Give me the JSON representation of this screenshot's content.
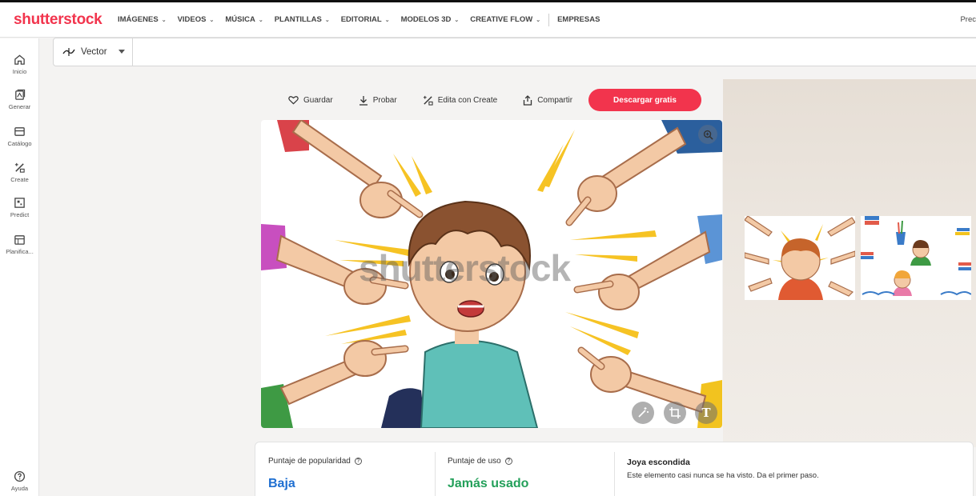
{
  "header": {
    "logo": "shutterstock",
    "nav": [
      {
        "label": "IMÁGENES",
        "caret": true
      },
      {
        "label": "VIDEOS",
        "caret": true
      },
      {
        "label": "MÚSICA",
        "caret": true
      },
      {
        "label": "PLANTILLAS",
        "caret": true
      },
      {
        "label": "EDITORIAL",
        "caret": true
      },
      {
        "label": "MODELOS 3D",
        "caret": true
      },
      {
        "label": "CREATIVE FLOW",
        "caret": true
      },
      {
        "label": "EMPRESAS",
        "caret": false
      }
    ],
    "right_text": "Prec"
  },
  "sidebar": {
    "items": [
      {
        "label": "Inicio",
        "icon": "home-icon"
      },
      {
        "label": "Generar",
        "icon": "generate-icon"
      },
      {
        "label": "Catálogo",
        "icon": "catalog-icon"
      },
      {
        "label": "Create",
        "icon": "create-icon"
      },
      {
        "label": "Predict",
        "icon": "predict-icon"
      },
      {
        "label": "Planifica...",
        "icon": "planner-icon"
      }
    ],
    "help": {
      "label": "Ayuda",
      "icon": "help-icon"
    }
  },
  "search": {
    "type_label": "Vector",
    "value": ""
  },
  "actions": {
    "save": "Guardar",
    "try": "Probar",
    "edit": "Edita con Create",
    "share": "Compartir",
    "download": "Descargar gratis"
  },
  "image": {
    "watermark": "shutterstock",
    "tools": [
      "magic-wand-icon",
      "crop-icon",
      "text-icon"
    ]
  },
  "stats": {
    "popularity_label": "Puntaje de popularidad",
    "popularity_value": "Baja",
    "usage_label": "Puntaje de uso",
    "usage_value": "Jamás usado",
    "gem_title": "Joya escondida",
    "gem_desc": "Este elemento casi nunca se ha visto. Da el primer paso."
  },
  "colors": {
    "brand": "#f2344d",
    "popularity": "#1f6fd1",
    "usage": "#23a05a"
  }
}
